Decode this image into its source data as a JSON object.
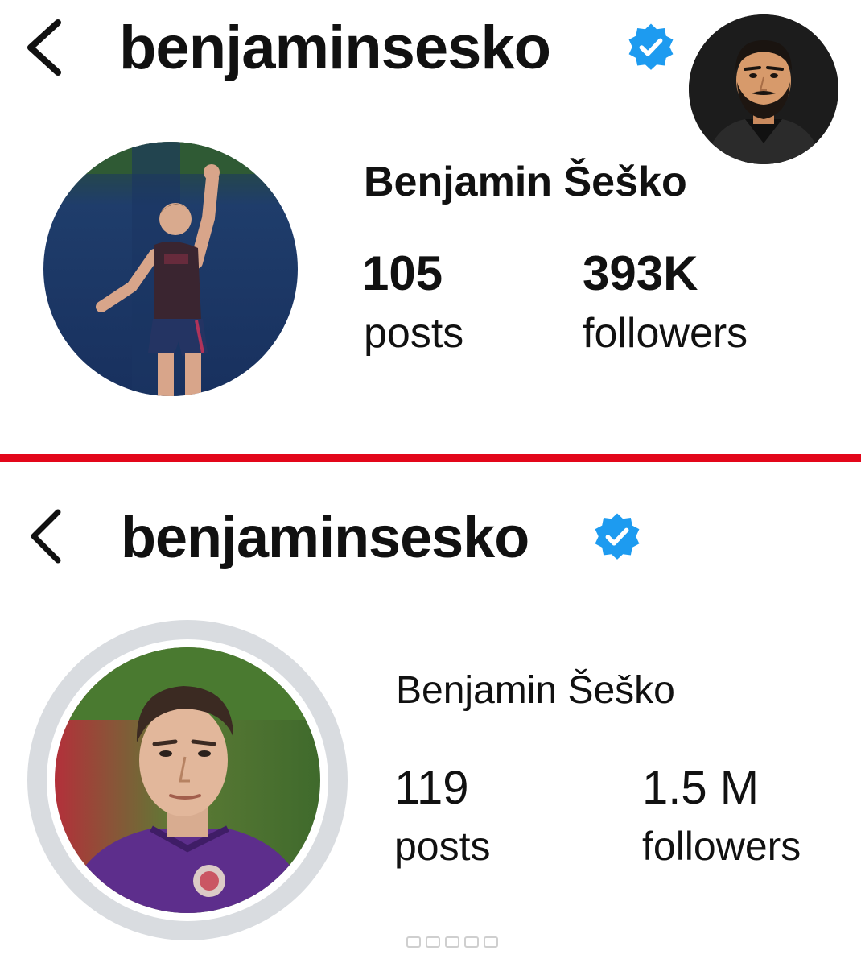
{
  "accent_color": "#1d9bf0",
  "divider_color": "#e3061a",
  "before": {
    "back_icon": "chevron-left-icon",
    "username": "benjaminsesko",
    "verified_icon": "verified-badge-icon",
    "full_name": "Benjamin Šeško",
    "posts": {
      "count": "105",
      "label": "posts"
    },
    "followers": {
      "count": "393K",
      "label": "followers"
    }
  },
  "after": {
    "back_icon": "chevron-left-icon",
    "username": "benjaminsesko",
    "verified_icon": "verified-badge-icon",
    "full_name": "Benjamin Šeško",
    "posts": {
      "count": "119",
      "label": "posts"
    },
    "followers": {
      "count": "1.5 M",
      "label": "followers"
    }
  }
}
